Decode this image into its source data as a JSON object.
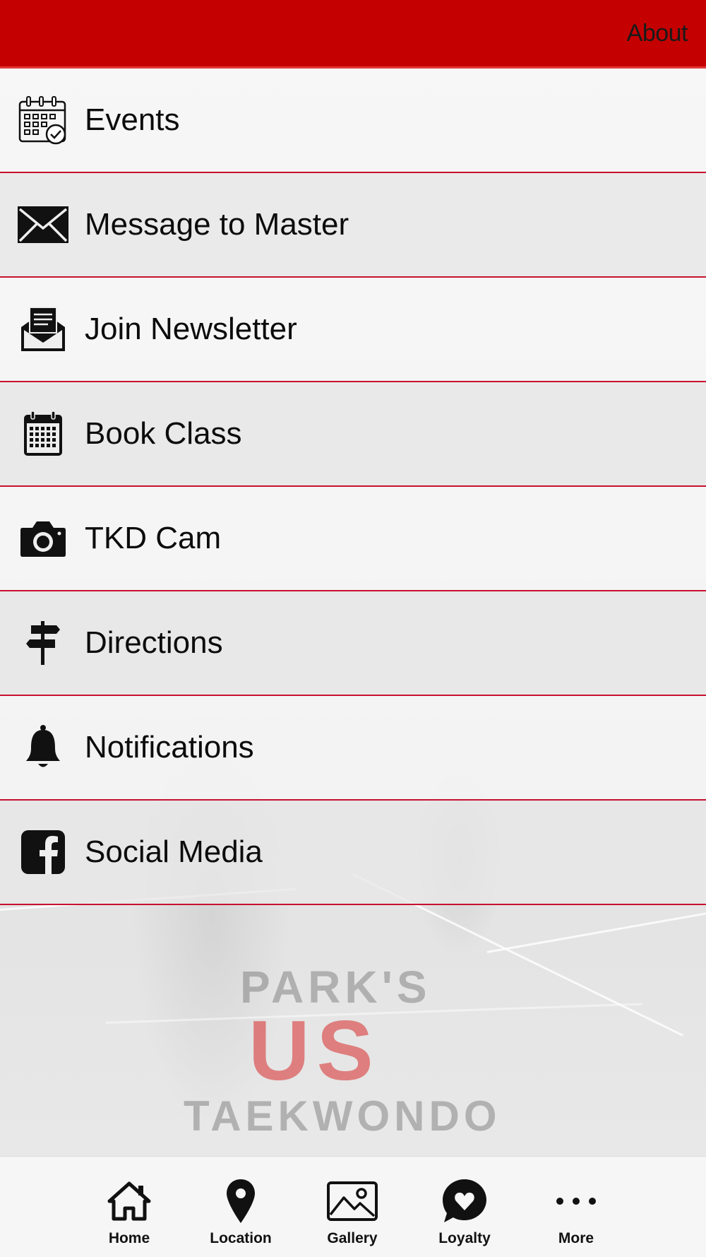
{
  "header": {
    "about_label": "About"
  },
  "menu": {
    "items": [
      {
        "label": "Events",
        "icon": "calendar-check-icon"
      },
      {
        "label": "Message to Master",
        "icon": "envelope-icon"
      },
      {
        "label": "Join Newsletter",
        "icon": "newsletter-icon"
      },
      {
        "label": "Book Class",
        "icon": "calendar-icon"
      },
      {
        "label": "TKD Cam",
        "icon": "camera-icon"
      },
      {
        "label": "Directions",
        "icon": "signpost-icon"
      },
      {
        "label": "Notifications",
        "icon": "bell-icon"
      },
      {
        "label": "Social Media",
        "icon": "facebook-icon"
      }
    ]
  },
  "logo": {
    "line1": "PARK'S",
    "line2": "US",
    "line3": "TAEKWONDO"
  },
  "tabbar": {
    "tabs": [
      {
        "label": "Home",
        "icon": "home-icon"
      },
      {
        "label": "Location",
        "icon": "location-pin-icon"
      },
      {
        "label": "Gallery",
        "icon": "gallery-icon"
      },
      {
        "label": "Loyalty",
        "icon": "heart-bubble-icon"
      },
      {
        "label": "More",
        "icon": "more-dots-icon"
      }
    ]
  },
  "colors": {
    "header": "#c40000",
    "divider": "#c8102e"
  }
}
